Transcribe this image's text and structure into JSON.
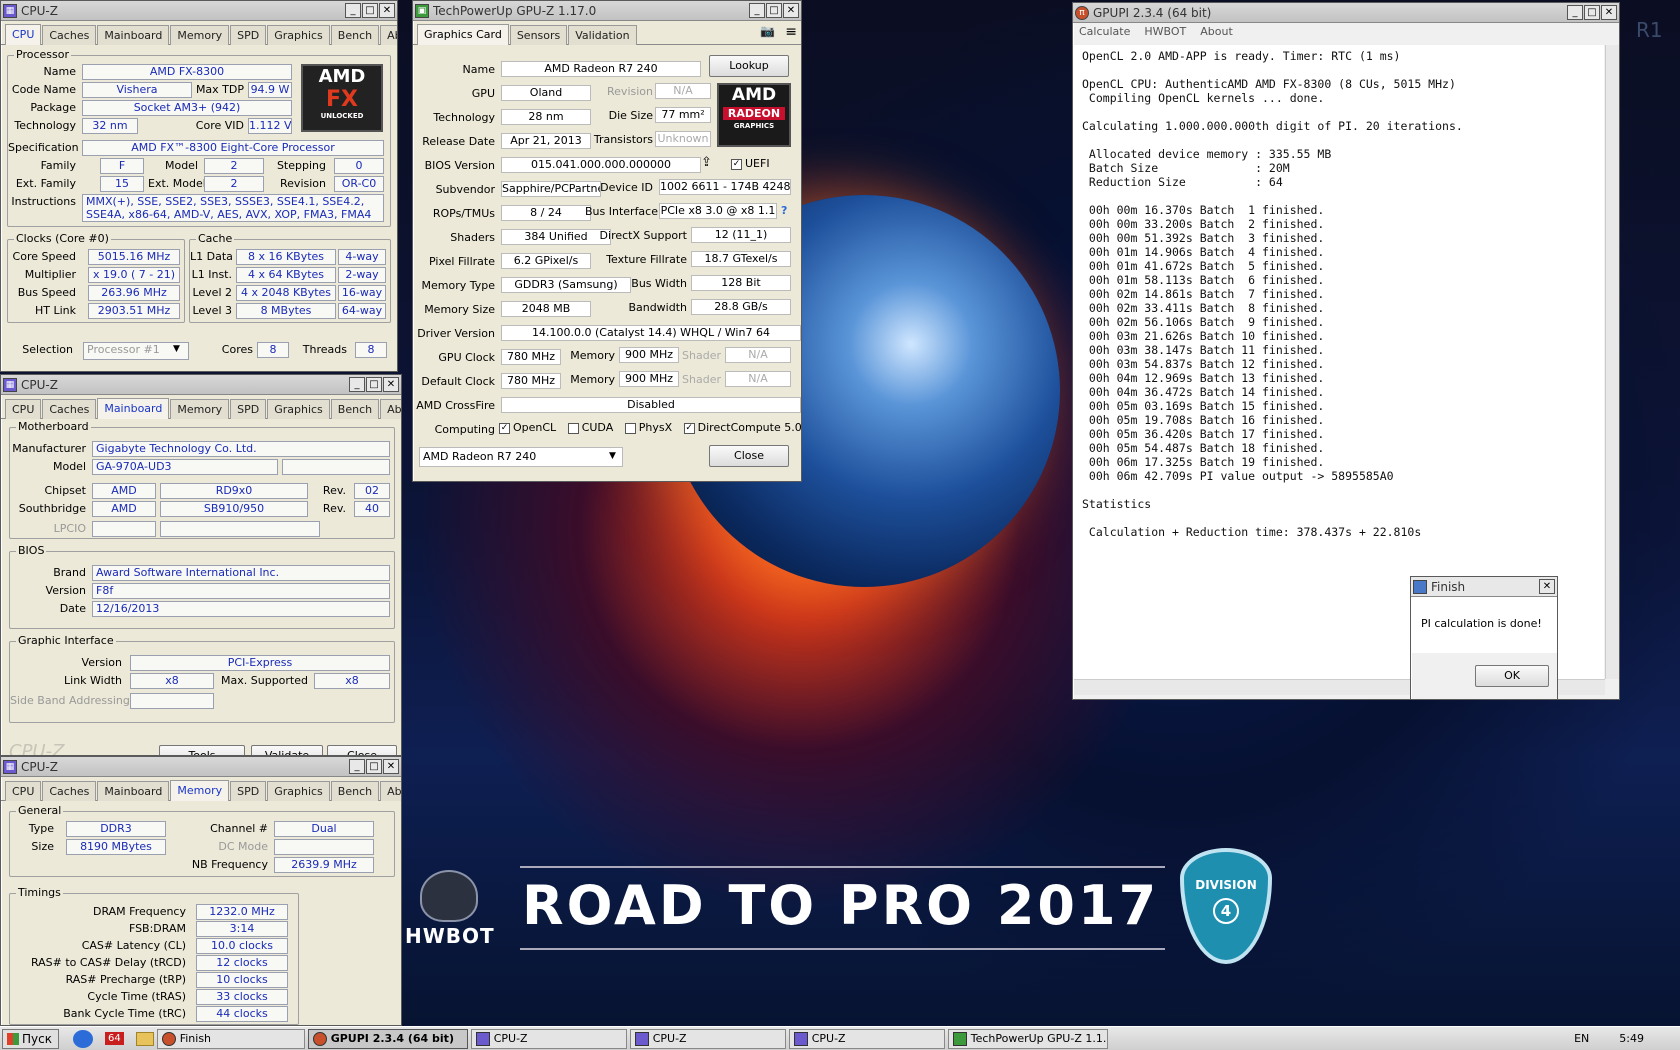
{
  "cpuz_main": {
    "title": "CPU-Z",
    "tabs": [
      "CPU",
      "Caches",
      "Mainboard",
      "Memory",
      "SPD",
      "Graphics",
      "Bench",
      "About"
    ],
    "processor_group": "Processor",
    "name_label": "Name",
    "name": "AMD FX-8300",
    "codename_label": "Code Name",
    "codename": "Vishera",
    "maxtdp_label": "Max TDP",
    "maxtdp": "94.9 W",
    "package_label": "Package",
    "package": "Socket AM3+ (942)",
    "tech_label": "Technology",
    "tech": "32 nm",
    "corevid_label": "Core VID",
    "corevid": "1.112 V",
    "spec_label": "Specification",
    "spec": "AMD FX™-8300 Eight-Core Processor",
    "family_label": "Family",
    "family": "F",
    "model_label": "Model",
    "model": "2",
    "stepping_label": "Stepping",
    "stepping": "0",
    "extfam_label": "Ext. Family",
    "extfam": "15",
    "extmodel_label": "Ext. Model",
    "extmodel": "2",
    "revision_label": "Revision",
    "revision": "OR-C0",
    "instr_label": "Instructions",
    "instr": "MMX(+), SSE, SSE2, SSE3, SSSE3, SSE4.1, SSE4.2, SSE4A, x86-64, AMD-V, AES, AVX, XOP, FMA3, FMA4",
    "clocks_group": "Clocks (Core #0)",
    "corespeed_label": "Core Speed",
    "corespeed": "5015.16 MHz",
    "mult_label": "Multiplier",
    "mult": "x 19.0 ( 7 - 21)",
    "bus_label": "Bus Speed",
    "bus": "263.96 MHz",
    "ht_label": "HT Link",
    "ht": "2903.51 MHz",
    "cache_group": "Cache",
    "l1d_label": "L1 Data",
    "l1d": "8 x 16 KBytes",
    "l1d_w": "4-way",
    "l1i_label": "L1 Inst.",
    "l1i": "4 x 64 KBytes",
    "l1i_w": "2-way",
    "l2_label": "Level 2",
    "l2": "4 x 2048 KBytes",
    "l2_w": "16-way",
    "l3_label": "Level 3",
    "l3": "8 MBytes",
    "l3_w": "64-way",
    "sel_label": "Selection",
    "sel": "Processor #1",
    "cores_label": "Cores",
    "cores": "8",
    "threads_label": "Threads",
    "threads": "8",
    "logo_brand": "AMD",
    "logo_line": "FX",
    "logo_sub": "UNLOCKED"
  },
  "cpuz_mb": {
    "title": "CPU-Z",
    "mb_group": "Motherboard",
    "manu_label": "Manufacturer",
    "manu": "Gigabyte Technology Co. Ltd.",
    "model_label": "Model",
    "model": "GA-970A-UD3",
    "chipset_label": "Chipset",
    "chipset_v": "AMD",
    "chipset_m": "RD9x0",
    "rev_label": "Rev.",
    "chipset_rev": "02",
    "sb_label": "Southbridge",
    "sb_v": "AMD",
    "sb_m": "SB910/950",
    "sb_rev": "40",
    "lpcio_label": "LPCIO",
    "bios_group": "BIOS",
    "brand_label": "Brand",
    "brand": "Award Software International Inc.",
    "ver_label": "Version",
    "ver": "F8f",
    "date_label": "Date",
    "date": "12/16/2013",
    "gi_group": "Graphic Interface",
    "giver_label": "Version",
    "giver": "PCI-Express",
    "lw_label": "Link Width",
    "lw": "x8",
    "ms_label": "Max. Supported",
    "ms": "x8",
    "sba_label": "Side Band Addressing",
    "ghost": "CPU-Z",
    "tools": "Tools",
    "validate": "Validate",
    "close": "Close"
  },
  "cpuz_mem": {
    "title": "CPU-Z",
    "gen_group": "General",
    "type_label": "Type",
    "type": "DDR3",
    "ch_label": "Channel #",
    "ch": "Dual",
    "size_label": "Size",
    "size": "8190 MBytes",
    "dc_label": "DC Mode",
    "nb_label": "NB Frequency",
    "nb": "2639.9 MHz",
    "tim_group": "Timings",
    "timings": [
      {
        "l": "DRAM Frequency",
        "v": "1232.0 MHz"
      },
      {
        "l": "FSB:DRAM",
        "v": "3:14"
      },
      {
        "l": "CAS# Latency (CL)",
        "v": "10.0 clocks"
      },
      {
        "l": "RAS# to CAS# Delay (tRCD)",
        "v": "12 clocks"
      },
      {
        "l": "RAS# Precharge (tRP)",
        "v": "10 clocks"
      },
      {
        "l": "Cycle Time (tRAS)",
        "v": "33 clocks"
      },
      {
        "l": "Bank Cycle Time (tRC)",
        "v": "44 clocks"
      }
    ]
  },
  "gpuz": {
    "title": "TechPowerUp GPU-Z 1.17.0",
    "tabs": [
      "Graphics Card",
      "Sensors",
      "Validation"
    ],
    "rows": [
      {
        "l": "Name",
        "v": "AMD Radeon R7 240"
      },
      {
        "l": "GPU",
        "v": "Oland"
      },
      {
        "l": "Technology",
        "v": "28 nm"
      },
      {
        "l": "Release Date",
        "v": "Apr 21, 2013"
      },
      {
        "l": "BIOS Version",
        "v": "015.041.000.000.000000"
      },
      {
        "l": "Subvendor",
        "v": "Sapphire/PCPartner"
      },
      {
        "l": "ROPs/TMUs",
        "v": "8 / 24"
      },
      {
        "l": "Shaders",
        "v": "384 Unified"
      },
      {
        "l": "Pixel Fillrate",
        "v": "6.2 GPixel/s"
      },
      {
        "l": "Memory Type",
        "v": "GDDR3 (Samsung)"
      },
      {
        "l": "Memory Size",
        "v": "2048 MB"
      },
      {
        "l": "Driver Version",
        "v": "14.100.0.0 (Catalyst 14.4) WHQL / Win7 64"
      },
      {
        "l": "GPU Clock",
        "v": "780 MHz"
      },
      {
        "l": "Default Clock",
        "v": "780 MHz"
      },
      {
        "l": "AMD CrossFire",
        "v": "Disabled"
      },
      {
        "l": "Computing",
        "v": ""
      }
    ],
    "lookup": "Lookup",
    "rev_label": "Revision",
    "rev": "N/A",
    "die_label": "Die Size",
    "die": "77 mm²",
    "trans_label": "Transistors",
    "trans": "Unknown",
    "uefi": "UEFI",
    "devid_label": "Device ID",
    "devid": "1002 6611 - 174B 4248",
    "busif_label": "Bus Interface",
    "busif": "PCIe x8 3.0 @ x8 1.1",
    "dx_label": "DirectX Support",
    "dx": "12 (11_1)",
    "tex_label": "Texture Fillrate",
    "tex": "18.7 GTexel/s",
    "bw_label": "Bus Width",
    "bw": "128 Bit",
    "band_label": "Bandwidth",
    "band": "28.8 GB/s",
    "mem_label": "Memory",
    "memclk": "900 MHz",
    "defmem": "900 MHz",
    "shader_label": "Shader",
    "shader": "N/A",
    "opencl": "OpenCL",
    "cuda": "CUDA",
    "physx": "PhysX",
    "dc": "DirectCompute 5.0",
    "select": "AMD Radeon R7 240",
    "close": "Close",
    "logo_brand": "AMD",
    "logo_line": "RADEON",
    "logo_sub": "GRAPHICS"
  },
  "gpupi": {
    "title": "GPUPI 2.3.4 (64 bit)",
    "menu": [
      "Calculate",
      "HWBOT",
      "About"
    ],
    "log": "OpenCL 2.0 AMD-APP is ready. Timer: RTC (1 ms)\n\nOpenCL CPU: AuthenticAMD AMD FX-8300 (8 CUs, 5015 MHz)\n Compiling OpenCL kernels ... done.\n\nCalculating 1.000.000.000th digit of PI. 20 iterations.\n\n Allocated device memory : 335.55 MB\n Batch Size              : 20M\n Reduction Size          : 64\n\n 00h 00m 16.370s Batch  1 finished.\n 00h 00m 33.200s Batch  2 finished.\n 00h 00m 51.392s Batch  3 finished.\n 00h 01m 14.906s Batch  4 finished.\n 00h 01m 41.672s Batch  5 finished.\n 00h 01m 58.113s Batch  6 finished.\n 00h 02m 14.861s Batch  7 finished.\n 00h 02m 33.411s Batch  8 finished.\n 00h 02m 56.106s Batch  9 finished.\n 00h 03m 21.626s Batch 10 finished.\n 00h 03m 38.147s Batch 11 finished.\n 00h 03m 54.837s Batch 12 finished.\n 00h 04m 12.969s Batch 13 finished.\n 00h 04m 36.472s Batch 14 finished.\n 00h 05m 03.169s Batch 15 finished.\n 00h 05m 19.708s Batch 16 finished.\n 00h 05m 36.420s Batch 17 finished.\n 00h 05m 54.487s Batch 18 finished.\n 00h 06m 17.325s Batch 19 finished.\n 00h 06m 42.709s PI value output -> 5895585A0\n\nStatistics\n\n Calculation + Reduction time: 378.437s + 22.810s"
  },
  "finish": {
    "title": "Finish",
    "msg": "PI calculation is done!",
    "ok": "OK"
  },
  "wallpaper": {
    "banner": "ROAD TO PRO 2017",
    "hwbot": "HWBOT",
    "division": "DIVISION",
    "div_num": "4",
    "corner": "R1"
  },
  "taskbar": {
    "start": "Пуск",
    "badge": "64",
    "items": [
      "Finish",
      "GPUPI 2.3.4 (64 bit)",
      "CPU-Z",
      "CPU-Z",
      "CPU-Z",
      "TechPowerUp GPU-Z 1.1..."
    ],
    "lang": "EN",
    "time": "5:49"
  }
}
